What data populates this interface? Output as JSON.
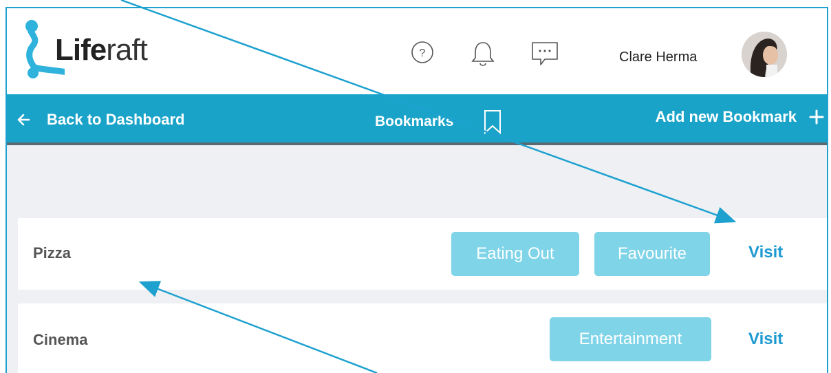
{
  "app": {
    "logo": {
      "bold": "Life",
      "light": "raft"
    },
    "user_name": "Clare Herma"
  },
  "icons": {
    "help": "help-circle-icon",
    "notifications": "bell-icon",
    "messages": "chat-bubble-icon",
    "back": "arrow-left-icon",
    "bookmark": "bookmark-icon",
    "add": "plus-icon"
  },
  "navbar": {
    "back_label": "Back to Dashboard",
    "title": "Bookmarks",
    "add_label": "Add new Bookmark"
  },
  "bookmarks": [
    {
      "title": "Pizza",
      "tags": [
        "Eating Out",
        "Favourite"
      ],
      "action": "Visit"
    },
    {
      "title": "Cinema",
      "tags": [
        "Entertainment"
      ],
      "action": "Visit"
    }
  ],
  "colors": {
    "accent": "#1aa3c8",
    "tag_bg": "#7fd4e8",
    "visit_link": "#1d9ad0",
    "annotation": "#1ea1cf",
    "content_bg": "#eef0f4"
  }
}
